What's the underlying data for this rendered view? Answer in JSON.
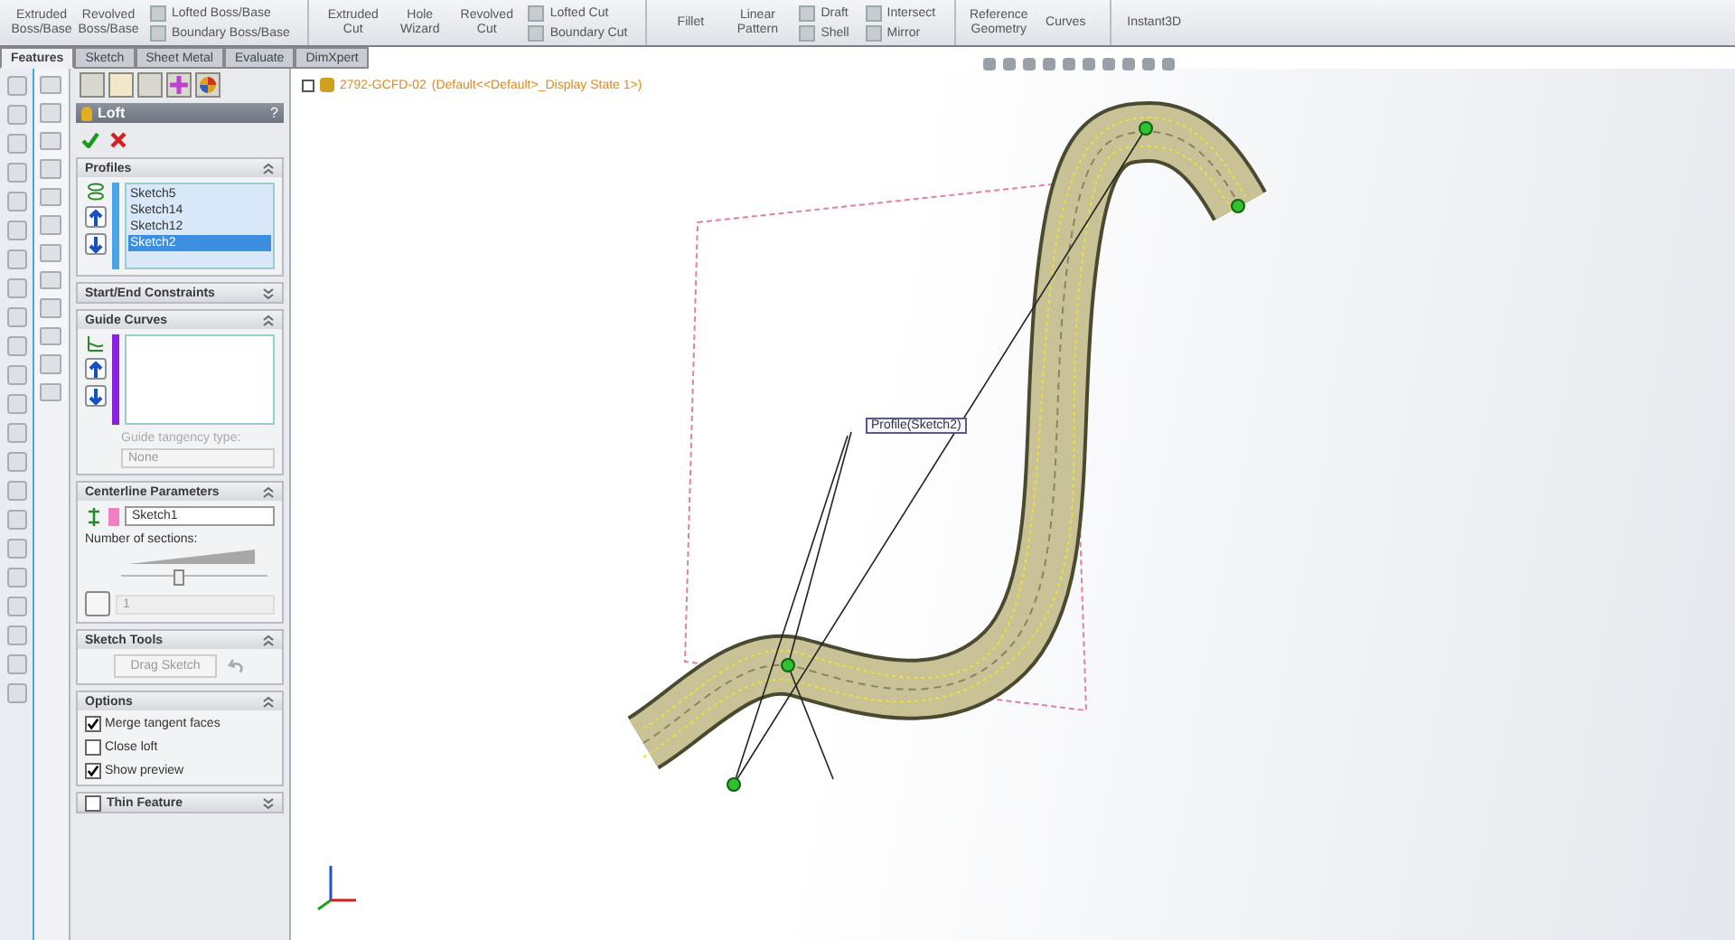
{
  "ribbon": [
    {
      "kind": "large",
      "label": "Extruded Boss/Base"
    },
    {
      "kind": "large",
      "label": "Revolved Boss/Base"
    },
    {
      "kind": "pair",
      "items": [
        "Lofted Boss/Base",
        "Boundary Boss/Base"
      ]
    },
    {
      "kind": "sep"
    },
    {
      "kind": "large",
      "label": "Extruded Cut"
    },
    {
      "kind": "large",
      "label": "Hole Wizard"
    },
    {
      "kind": "large",
      "label": "Revolved Cut"
    },
    {
      "kind": "pair",
      "items": [
        "Lofted Cut",
        "Boundary Cut"
      ]
    },
    {
      "kind": "sep"
    },
    {
      "kind": "large",
      "label": "Fillet"
    },
    {
      "kind": "large",
      "label": "Linear Pattern"
    },
    {
      "kind": "pair",
      "items": [
        "Draft",
        "Shell"
      ]
    },
    {
      "kind": "pair",
      "items": [
        "Intersect",
        "Mirror"
      ]
    },
    {
      "kind": "sep"
    },
    {
      "kind": "large",
      "label": "Reference Geometry"
    },
    {
      "kind": "large",
      "label": "Curves"
    },
    {
      "kind": "sep"
    },
    {
      "kind": "large",
      "label": "Instant3D"
    }
  ],
  "tabs": [
    {
      "label": "Features",
      "selected": true
    },
    {
      "label": "Sketch",
      "selected": false
    },
    {
      "label": "Sheet Metal",
      "selected": false
    },
    {
      "label": "Evaluate",
      "selected": false
    },
    {
      "label": "DimXpert",
      "selected": false
    }
  ],
  "tree": {
    "name": "2792-GCFD-02",
    "config": "(Default<<Default>_Display State 1>)"
  },
  "property_manager": {
    "title": "Loft",
    "help": "?",
    "sections": [
      {
        "kind": "profiles",
        "title": "Profiles",
        "expanded": true,
        "items": [
          {
            "label": "Sketch5",
            "selected": false
          },
          {
            "label": "Sketch14",
            "selected": false
          },
          {
            "label": "Sketch12",
            "selected": false
          },
          {
            "label": "Sketch2",
            "selected": true
          }
        ]
      },
      {
        "kind": "header",
        "title": "Start/End Constraints",
        "expanded": false
      },
      {
        "kind": "guides",
        "title": "Guide Curves",
        "expanded": true,
        "type_label": "Guide tangency type:",
        "type_value": "None"
      },
      {
        "kind": "centerline",
        "title": "Centerline Parameters",
        "expanded": true,
        "value": "Sketch1",
        "sections_label": "Number of sections:",
        "level": 0.4,
        "count": "1"
      },
      {
        "kind": "tools",
        "title": "Sketch Tools",
        "expanded": true,
        "button": "Drag Sketch"
      },
      {
        "kind": "options",
        "title": "Options",
        "expanded": true,
        "items": [
          {
            "label": "Merge tangent faces",
            "checked": true
          },
          {
            "label": "Close loft",
            "checked": false
          },
          {
            "label": "Show preview",
            "checked": true
          }
        ]
      },
      {
        "kind": "check",
        "title": "Thin Feature",
        "expanded": false,
        "checked": false
      }
    ]
  },
  "callout": "Profile(Sketch2)"
}
